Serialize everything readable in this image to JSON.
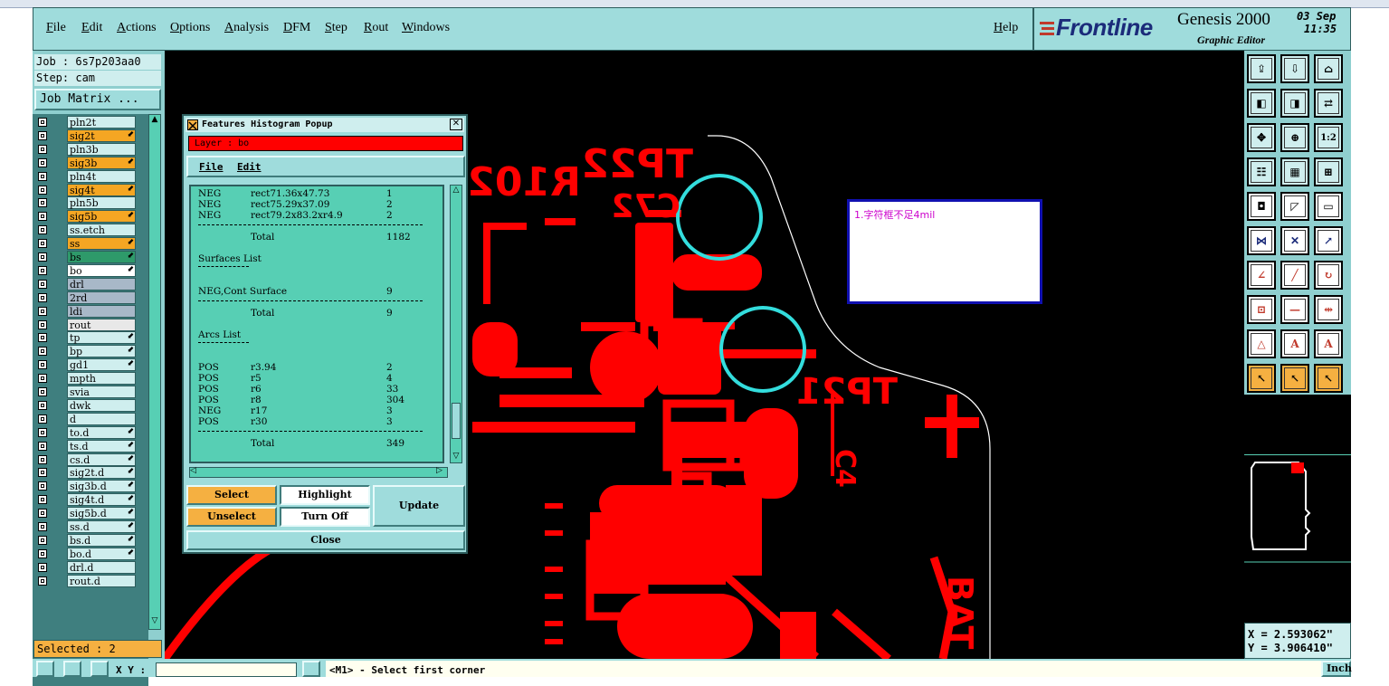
{
  "menu": {
    "items": [
      "File",
      "Edit",
      "Actions",
      "Options",
      "Analysis",
      "DFM",
      "Step",
      "Rout",
      "Windows"
    ],
    "help": "Help"
  },
  "brand": {
    "logo": "Frontline",
    "product": "Genesis 2000",
    "subtitle": "Graphic Editor",
    "date": "03 Sep",
    "time": "11:35"
  },
  "job": {
    "job_label": "Job : 6s7p203aa0",
    "step_label": "Step: cam",
    "matrix_button": "Job Matrix ..."
  },
  "layers": [
    {
      "name": "pln2t",
      "color": "#cfeeee",
      "arrow": false
    },
    {
      "name": "sig2t",
      "color": "#f5a623",
      "arrow": true
    },
    {
      "name": "pln3b",
      "color": "#cfeeee",
      "arrow": false
    },
    {
      "name": "sig3b",
      "color": "#f5a623",
      "arrow": true
    },
    {
      "name": "pln4t",
      "color": "#cfeeee",
      "arrow": false
    },
    {
      "name": "sig4t",
      "color": "#f5a623",
      "arrow": true
    },
    {
      "name": "pln5b",
      "color": "#cfeeee",
      "arrow": false
    },
    {
      "name": "sig5b",
      "color": "#f5a623",
      "arrow": true
    },
    {
      "name": "ss.etch",
      "color": "#cfeeee",
      "arrow": false
    },
    {
      "name": "ss",
      "color": "#f5a623",
      "arrow": true
    },
    {
      "name": "bs",
      "color": "#2e9a6a",
      "arrow": true
    },
    {
      "name": "bo",
      "color": "#ffffff",
      "arrow": true
    },
    {
      "name": "drl",
      "color": "#a8b8c8",
      "arrow": false
    },
    {
      "name": "2rd",
      "color": "#a8b8c8",
      "arrow": false
    },
    {
      "name": "ldi",
      "color": "#a8b8c8",
      "arrow": false
    },
    {
      "name": "rout",
      "color": "#e8e8e8",
      "arrow": false
    },
    {
      "name": "tp",
      "color": "#cfeeee",
      "arrow": true
    },
    {
      "name": "bp",
      "color": "#cfeeee",
      "arrow": true
    },
    {
      "name": "gd1",
      "color": "#cfeeee",
      "arrow": true
    },
    {
      "name": "mpth",
      "color": "#cfeeee",
      "arrow": false
    },
    {
      "name": "svia",
      "color": "#cfeeee",
      "arrow": false
    },
    {
      "name": "dwk",
      "color": "#cfeeee",
      "arrow": false
    },
    {
      "name": "d",
      "color": "#cfeeee",
      "arrow": false
    },
    {
      "name": "to.d",
      "color": "#cfeeee",
      "arrow": true
    },
    {
      "name": "ts.d",
      "color": "#cfeeee",
      "arrow": true
    },
    {
      "name": "cs.d",
      "color": "#cfeeee",
      "arrow": true
    },
    {
      "name": "sig2t.d",
      "color": "#cfeeee",
      "arrow": true
    },
    {
      "name": "sig3b.d",
      "color": "#cfeeee",
      "arrow": true
    },
    {
      "name": "sig4t.d",
      "color": "#cfeeee",
      "arrow": true
    },
    {
      "name": "sig5b.d",
      "color": "#cfeeee",
      "arrow": true
    },
    {
      "name": "ss.d",
      "color": "#cfeeee",
      "arrow": true
    },
    {
      "name": "bs.d",
      "color": "#cfeeee",
      "arrow": true
    },
    {
      "name": "bo.d",
      "color": "#cfeeee",
      "arrow": true
    },
    {
      "name": "drl.d",
      "color": "#cfeeee",
      "arrow": false
    },
    {
      "name": "rout.d",
      "color": "#cfeeee",
      "arrow": false
    }
  ],
  "selected_label": "Selected : 2",
  "popup": {
    "title": "Features Histogram Popup",
    "layer_label": "Layer :  bo",
    "menu": [
      "File",
      "Edit"
    ],
    "rows": [
      {
        "pol": "NEG",
        "sym": "rect71.36x47.73",
        "count": "1"
      },
      {
        "pol": "NEG",
        "sym": "rect75.29x37.09",
        "count": "2"
      },
      {
        "pol": "NEG",
        "sym": "rect79.2x83.2xr4.9",
        "count": "2"
      }
    ],
    "total1": "1182",
    "surfaces_header": "Surfaces List",
    "surface_row": {
      "sym": "NEG,Cont Surface",
      "count": "9"
    },
    "total2": "9",
    "arcs_header": "Arcs List",
    "arc_rows": [
      {
        "pol": "POS",
        "sym": "r3.94",
        "count": "2"
      },
      {
        "pol": "POS",
        "sym": "r5",
        "count": "4"
      },
      {
        "pol": "POS",
        "sym": "r6",
        "count": "33"
      },
      {
        "pol": "POS",
        "sym": "r8",
        "count": "304"
      },
      {
        "pol": "NEG",
        "sym": "r17",
        "count": "3"
      },
      {
        "pol": "POS",
        "sym": "r30",
        "count": "3"
      }
    ],
    "total3": "349",
    "total_label": "Total",
    "buttons": {
      "select": "Select",
      "unselect": "Unselect",
      "highlight": "Highlight",
      "turn_off": "Turn Off",
      "update": "Update",
      "close": "Close"
    }
  },
  "canvas": {
    "note": "1.字符框不足4mil",
    "pcb_labels": [
      "TP22",
      "R102",
      "C72",
      "TP21",
      "C4",
      "BAT"
    ]
  },
  "coords": {
    "x": "X = 2.593062\"",
    "y": "Y = 3.906410\""
  },
  "status": {
    "xy_label": "X Y :",
    "xy_value": "",
    "prompt": "<M1> - Select first corner",
    "units": "Inch"
  },
  "colors": {
    "panel": "#9fdcdc",
    "pcb_red": "#ff0000",
    "highlight_cyan": "#33dddd",
    "button_orange": "#f5b041"
  }
}
